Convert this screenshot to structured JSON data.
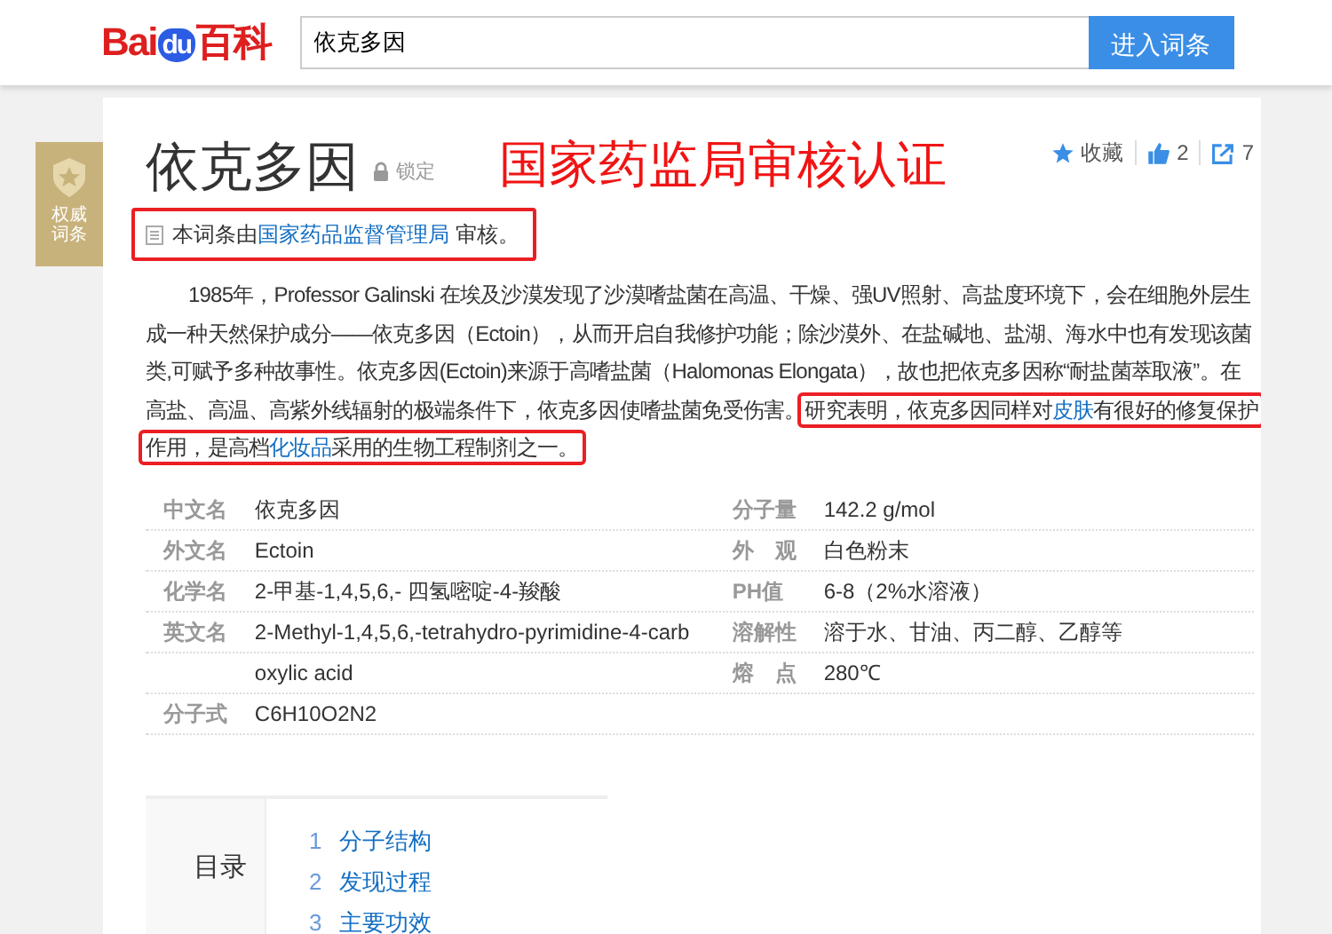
{
  "header": {
    "logo": {
      "left": "Bai",
      "middle": "du",
      "right": "百科"
    },
    "search": {
      "value": "依克多因"
    },
    "search_button": "进入词条"
  },
  "badge": {
    "lines": [
      "权威",
      "词条"
    ]
  },
  "actions": [
    {
      "kind": "star",
      "label": "收藏"
    },
    {
      "kind": "like",
      "label": "2"
    },
    {
      "kind": "share",
      "label": "7"
    }
  ],
  "title": "依克多因",
  "lock_label": "锁定",
  "annotation": "国家药监局审核认证",
  "review": {
    "prefix": "本词条由",
    "link": "国家药品监督管理局",
    "suffix": " 审核。"
  },
  "paragraph": [
    {
      "text": "1985年，Professor Galinski 在埃及沙漠发现了沙漠嗜盐菌在高温、干燥、强UV照射、高盐度环境下，会在细胞外层生成一种天然保护成分——依克多因（Ectoin），从而开启自我修护功能；除沙漠外、在盐碱地、盐湖、海水中也有发现该菌类,可赋予多种故事性。依克多因(Ectoin)来源于高嗜盐菌（Halomonas Elongata），故也把依克多因称“耐盐菌萃取液”。在高盐、高温、高紫外线辐射的极端条件下，依克多因使嗜盐菌免受伤害。",
      "highlighted": false
    },
    {
      "parts": [
        {
          "kind": "text",
          "text": "研究表明，依克多因同样对"
        },
        {
          "kind": "link",
          "text": "皮肤"
        },
        {
          "kind": "text",
          "text": "有很好的修复保护作用，是高档"
        },
        {
          "kind": "link",
          "text": "化妆品"
        },
        {
          "kind": "text",
          "text": "采用的生物工程制剂之一。"
        }
      ],
      "highlighted": true
    }
  ],
  "infobox": {
    "rows": [
      {
        "left": {
          "label": "中文名",
          "value": "依克多因"
        },
        "right": {
          "label": "分子量",
          "value": "142.2 g/mol"
        }
      },
      {
        "left": {
          "label": "外文名",
          "value": "Ectoin"
        },
        "right": {
          "label": "外　观",
          "value": "白色粉末"
        }
      },
      {
        "left": {
          "label": "化学名",
          "value": "2-甲基-1,4,5,6,- 四氢嘧啶-4-羧酸"
        },
        "right": {
          "label": "PH值",
          "value": "6-8（2%水溶液）"
        }
      },
      {
        "left": {
          "label": "英文名",
          "value": "2-Methyl-1,4,5,6,-tetrahydro-pyrimidine-4-carb"
        },
        "right": {
          "label": "溶解性",
          "value": "溶于水、甘油、丙二醇、乙醇等"
        }
      },
      {
        "left": {
          "value": "oxylic acid"
        },
        "right": {
          "label": "熔　点",
          "value": "280℃"
        }
      },
      {
        "left": {
          "label": "分子式",
          "value": "C6H10O2N2"
        }
      }
    ]
  },
  "toc": {
    "heading": "目录",
    "items": [
      {
        "number": "1",
        "label": "分子结构"
      },
      {
        "number": "2",
        "label": "发现过程"
      },
      {
        "number": "3",
        "label": "主要功效"
      }
    ]
  }
}
